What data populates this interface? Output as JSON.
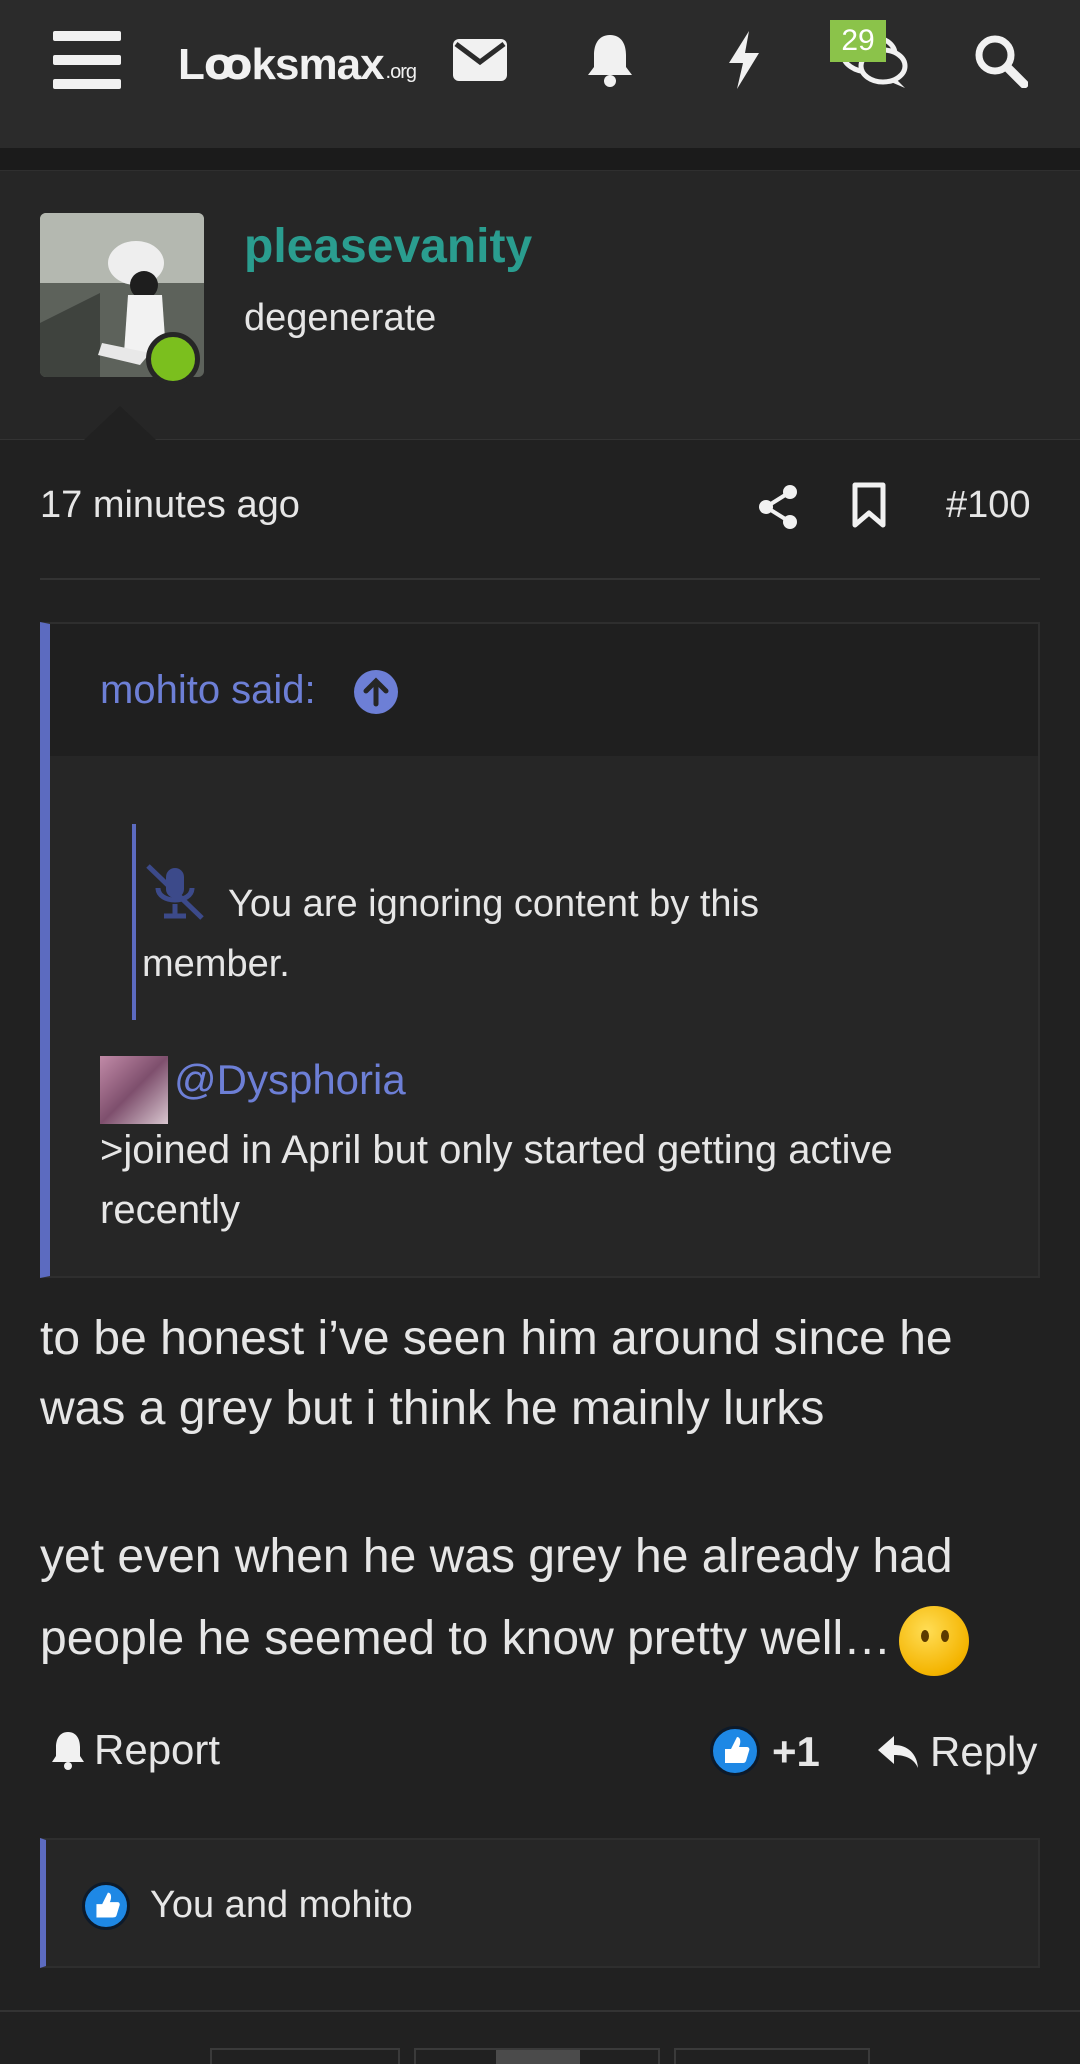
{
  "nav": {
    "logo_main": "Lꝏksmax",
    "logo_suffix": ".org",
    "conversations_badge": "29",
    "icons": [
      "menu-icon",
      "mail-icon",
      "bell-icon",
      "bolt-icon",
      "conversations-icon",
      "search-icon"
    ]
  },
  "user": {
    "name": "pleasevanity",
    "title": "degenerate",
    "online": true
  },
  "post": {
    "time": "17 minutes ago",
    "number": "#100",
    "quote": {
      "author": "mohito said:",
      "ignored_text": "You are ignoring content by this member.",
      "mention": "@Dysphoria",
      "text": ">joined in April but only started getting active recently"
    },
    "body_paragraph_1": "to be honest i’ve seen him around since he was a grey but i think he mainly lurks",
    "body_paragraph_2": "yet even when he was grey he already had people he seemed to know pretty well…",
    "body_emoji": "thinking-face-emoji"
  },
  "actions": {
    "report": "Report",
    "like_count": "+1",
    "reply": "Reply"
  },
  "reactions": {
    "text": "You and mohito"
  },
  "colors": {
    "accent_teal": "#2a9d8f",
    "quote_blue": "#5c6bc0",
    "link_blue": "#6d7fd6",
    "online_green": "#7bbf1e",
    "badge_green": "#8bc34a",
    "like_blue": "#1e88e5"
  }
}
